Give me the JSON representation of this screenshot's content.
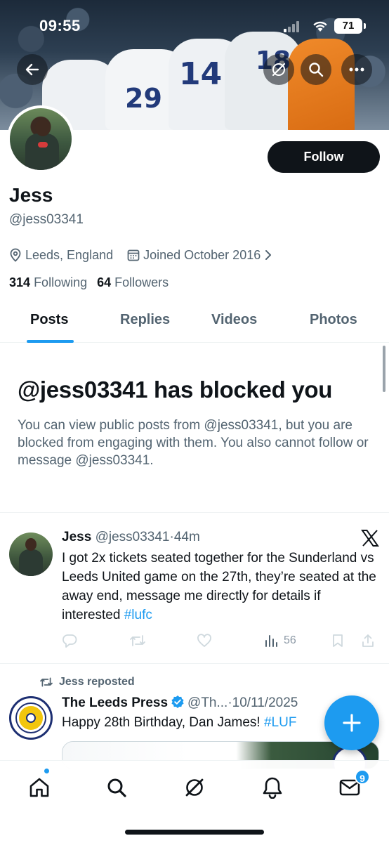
{
  "status_bar": {
    "time": "09:55",
    "battery": "71"
  },
  "profile": {
    "name": "Jess",
    "handle": "@jess03341",
    "location": "Leeds, England",
    "joined": "Joined October 2016",
    "following_count": "314",
    "following_label": "Following",
    "followers_count": "64",
    "followers_label": "Followers",
    "follow_button": "Follow"
  },
  "banner": {
    "jersey_numbers": [
      "14",
      "29",
      "18"
    ]
  },
  "tabs": [
    {
      "label": "Posts",
      "active": true
    },
    {
      "label": "Replies",
      "active": false
    },
    {
      "label": "Videos",
      "active": false
    },
    {
      "label": "Photos",
      "active": false
    }
  ],
  "blocked": {
    "title": "@jess03341 has blocked you",
    "body": "You can view public posts from @jess03341, but you are blocked from engaging with them. You also cannot follow or message @jess03341."
  },
  "post": {
    "author": "Jess",
    "handle": "@jess03341",
    "separator": "·",
    "time": "44m",
    "text": "I got 2x tickets seated together for the Sunderland vs Leeds United game on the 27th, they’re seated at the away end, message me directly for details if interested ",
    "hashtag": "#lufc",
    "views": "56",
    "source_icon": "x-logo-icon"
  },
  "repost": {
    "reposted_by": "Jess reposted",
    "author": "The Leeds Press",
    "handle": "@Th...",
    "separator": "·",
    "date": "10/11/2025",
    "text": "Happy 28th Birthday, Dan James! ",
    "hashtag": "#LUF",
    "avatar_text": [
      "THE LEEDS",
      "PRESS"
    ]
  },
  "bottom_nav": {
    "messages_badge": "9"
  },
  "colors": {
    "accent": "#1d9bf0",
    "text": "#0f1419",
    "secondary": "#536471"
  }
}
